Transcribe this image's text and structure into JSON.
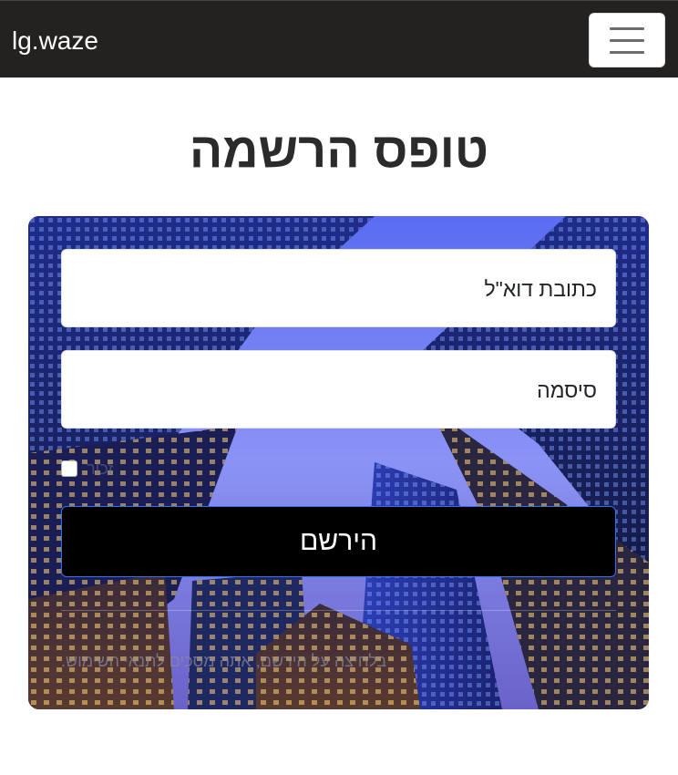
{
  "navbar": {
    "brand": "lg.waze",
    "toggler_icon": "hamburger-menu-icon"
  },
  "page": {
    "title": "טופס הרשמה"
  },
  "form": {
    "email_placeholder": "כתובת דוא\"ל",
    "password_placeholder": "סיסמה",
    "remember_label": "זכור",
    "remember_checked": false,
    "submit_label": "הירשם",
    "terms_text": "בלחיצה על הירשם, אתה מסכים לתנאי השימוש."
  },
  "colors": {
    "navbar_bg": "#242220",
    "submit_bg": "#000000",
    "submit_border": "#3b6ff0"
  }
}
